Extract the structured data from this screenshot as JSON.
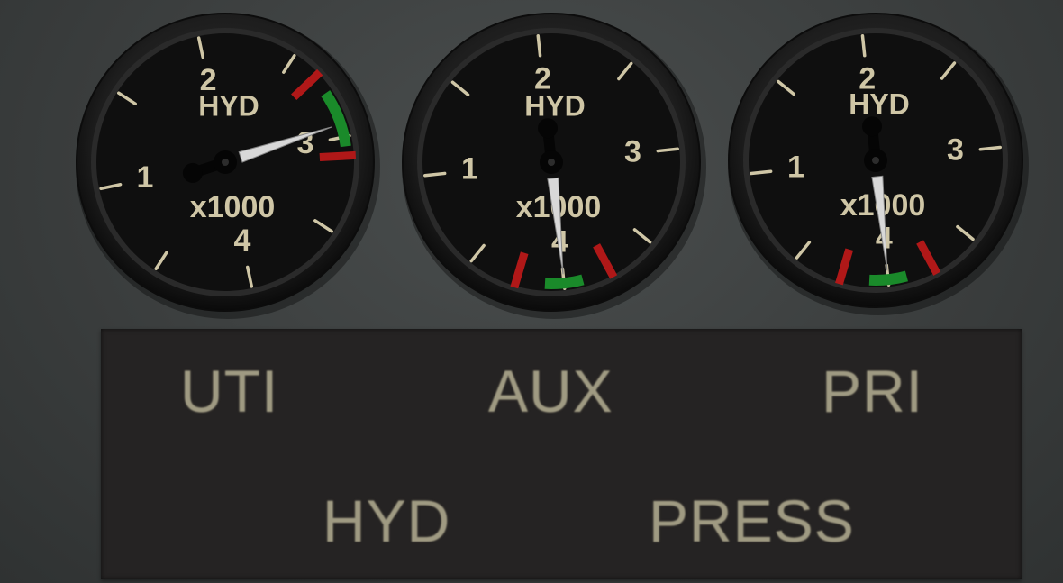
{
  "gauges": [
    {
      "id": "uti",
      "reading": 2.93,
      "scale_labels": [
        "1",
        "2",
        "3",
        "4"
      ],
      "title": "HYD",
      "multiplier": "x1000",
      "green_arc": [
        2.75,
        3.05
      ],
      "red_marks": [
        2.65,
        3.1
      ]
    },
    {
      "id": "aux",
      "reading": 0.0,
      "scale_labels": [
        "1",
        "2",
        "3",
        "4"
      ],
      "title": "HYD",
      "multiplier": "x1000",
      "green_arc": [
        -0.1,
        0.1
      ],
      "red_marks": [
        -0.25,
        0.25
      ]
    },
    {
      "id": "pri",
      "reading": 0.0,
      "scale_labels": [
        "1",
        "2",
        "3",
        "4"
      ],
      "title": "HYD",
      "multiplier": "x1000",
      "green_arc": [
        -0.1,
        0.1
      ],
      "red_marks": [
        -0.25,
        0.25
      ]
    }
  ],
  "panel": {
    "labels": {
      "uti": "UTI",
      "aux": "AUX",
      "pri": "PRI",
      "hyd": "HYD",
      "press": "PRESS"
    }
  },
  "colors": {
    "dial_face": "#0f0f0f",
    "markings": "#cfc6a6",
    "green_range": "#1a8a2a",
    "red_limit": "#b01818",
    "needle": "#d8d8d8"
  }
}
